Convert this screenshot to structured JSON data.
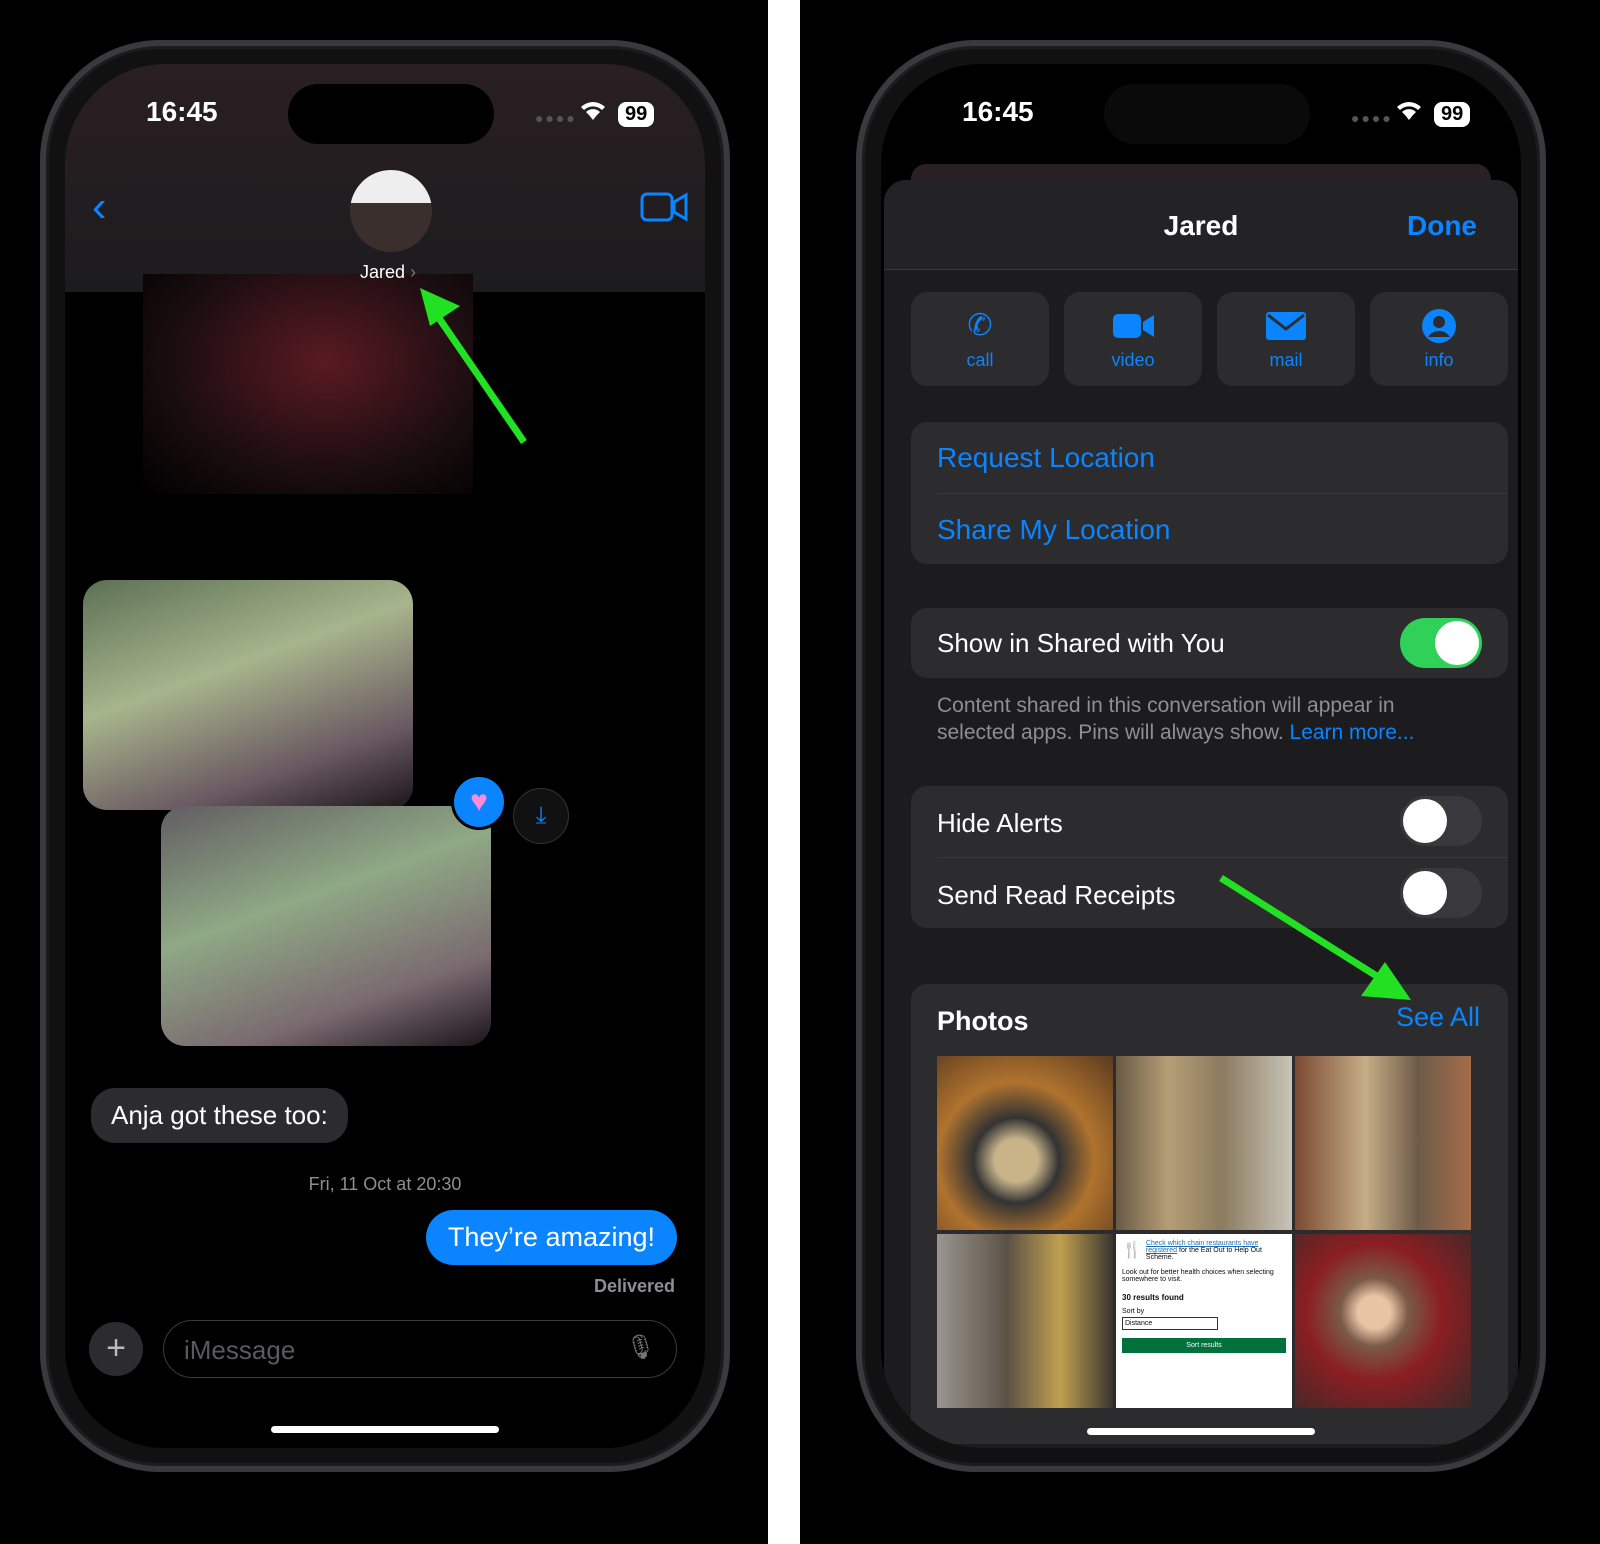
{
  "left": {
    "status": {
      "time": "16:45",
      "battery": "99"
    },
    "header": {
      "contact_name": "Jared",
      "chevron": "›"
    },
    "messages": {
      "received": "Anja got these too:",
      "timestamp": "Fri, 11 Oct at 20:30",
      "sent": "They’re amazing!",
      "sent_status": "Delivered"
    },
    "composer": {
      "placeholder": "iMessage"
    },
    "icons": [
      "back-chevron",
      "video-camera",
      "heart-reaction",
      "save-download",
      "plus",
      "microphone"
    ]
  },
  "right": {
    "status": {
      "time": "16:45",
      "battery": "99"
    },
    "sheet": {
      "title": "Jared",
      "done_label": "Done"
    },
    "actions": [
      {
        "label": "call",
        "icon": "phone"
      },
      {
        "label": "video",
        "icon": "video"
      },
      {
        "label": "mail",
        "icon": "envelope"
      },
      {
        "label": "info",
        "icon": "person-circle"
      }
    ],
    "location": {
      "request": "Request Location",
      "share": "Share My Location"
    },
    "shared_with_you": {
      "label": "Show in Shared with You",
      "on": true,
      "footer": "Content shared in this conversation will appear in selected apps. Pins will always show.",
      "learn_more": "Learn more..."
    },
    "toggles": [
      {
        "label": "Hide Alerts",
        "on": false
      },
      {
        "label": "Send Read Receipts",
        "on": false
      }
    ],
    "photos": {
      "title": "Photos",
      "see_all": "See All",
      "webpage_thumb": {
        "link": "Check which chain restaurants have registered",
        "text": "for the Eat Out to Help Out Scheme.",
        "hint": "Look out for better health choices when selecting somewhere to visit.",
        "results": "30 results found",
        "sort_label": "Sort by",
        "sort_value": "Distance",
        "button": "Sort results"
      }
    }
  },
  "colors": {
    "accent": "#0a84ff",
    "toggle_on": "#30d158",
    "annotation_arrow": "#22e022"
  }
}
